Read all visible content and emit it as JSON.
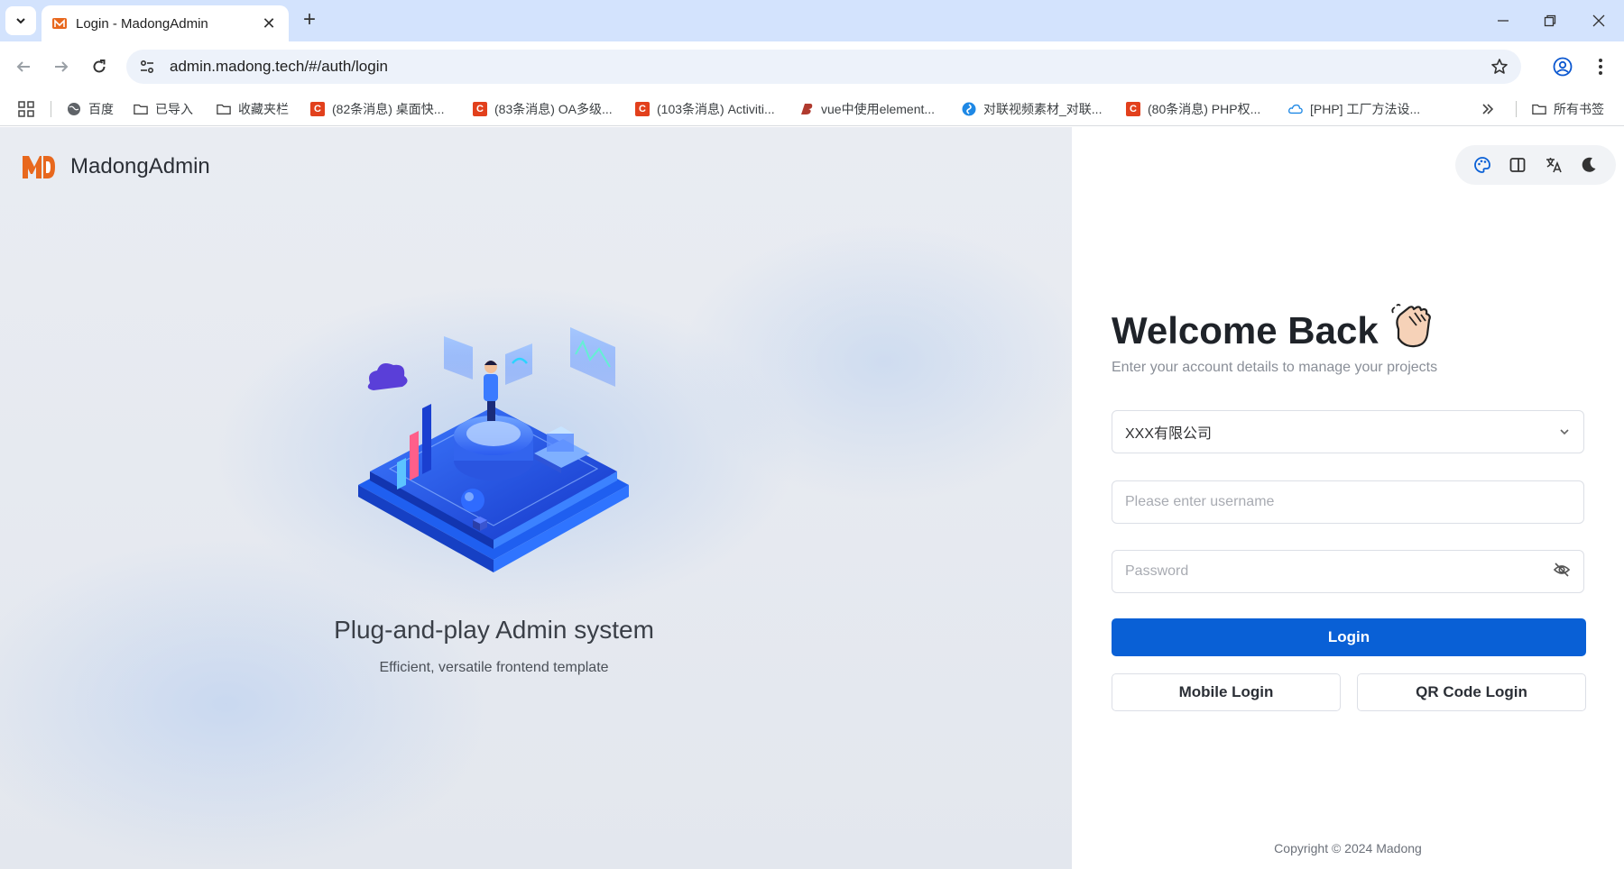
{
  "browser": {
    "tab_title": "Login - MadongAdmin",
    "url": "admin.madong.tech/#/auth/login",
    "bookmarks": [
      {
        "label": "百度",
        "icon": "globe-icon"
      },
      {
        "label": "已导入",
        "icon": "folder-icon"
      },
      {
        "label": "收藏夹栏",
        "icon": "folder-icon"
      },
      {
        "label": "(82条消息) 桌面快...",
        "icon": "csdn-icon"
      },
      {
        "label": "(83条消息) OA多级...",
        "icon": "csdn-icon"
      },
      {
        "label": "(103条消息) Activiti...",
        "icon": "csdn-icon"
      },
      {
        "label": "vue中使用element...",
        "icon": "b-icon"
      },
      {
        "label": "对联视频素材_对联...",
        "icon": "swirl-icon"
      },
      {
        "label": "(80条消息) PHP权...",
        "icon": "csdn-icon"
      },
      {
        "label": "[PHP] 工厂方法设...",
        "icon": "cloud-icon"
      }
    ],
    "all_bookmarks": "所有书签"
  },
  "brand": {
    "name": "MadongAdmin",
    "logo_color": "#e8681e"
  },
  "hero": {
    "title": "Plug-and-play Admin system",
    "subtitle": "Efficient, versatile frontend template"
  },
  "login": {
    "welcome": "Welcome Back",
    "welcome_emoji": "👏🏻",
    "subtitle": "Enter your account details to manage your projects",
    "tenant_selected": "XXX有限公司",
    "username_placeholder": "Please enter username",
    "password_placeholder": "Password",
    "login_button": "Login",
    "mobile_login": "Mobile Login",
    "qr_login": "QR Code Login",
    "copyright": "Copyright © 2024 Madong"
  },
  "colors": {
    "primary": "#0960d6",
    "tab_strip": "#d3e3fd"
  }
}
